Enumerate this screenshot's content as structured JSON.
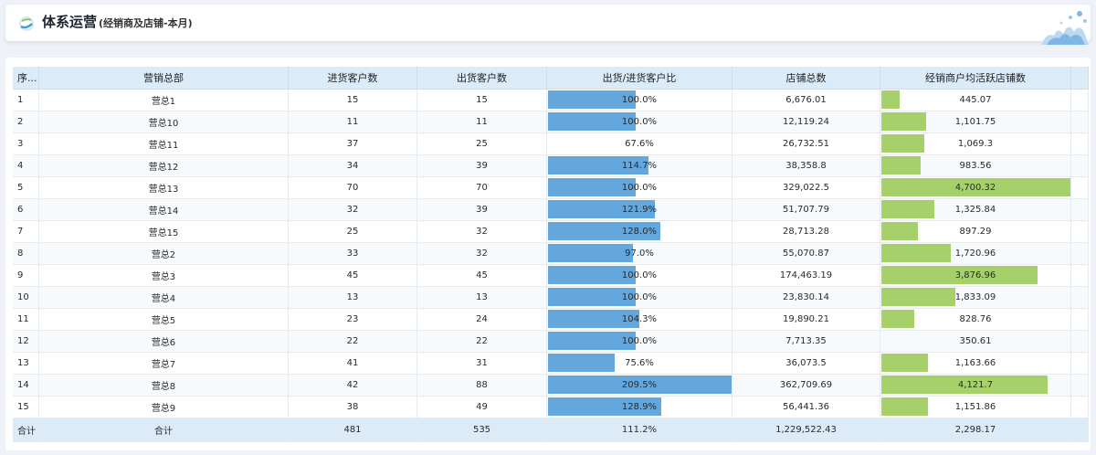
{
  "header": {
    "title": "体系运营",
    "subtitle": "(经销商及店铺-本月)"
  },
  "colors": {
    "ratio_bar": "#63a7dd",
    "avg_bar": "#a6d16a",
    "header_bg": "#dcebf8"
  },
  "table": {
    "columns": [
      "序...",
      "营销总部",
      "进货客户数",
      "出货客户数",
      "出货/进货客户比",
      "店铺总数",
      "经销商户均活跃店铺数"
    ],
    "rows": [
      {
        "idx": "1",
        "dept": "营总1",
        "in": "15",
        "out": "15",
        "ratio": "100.0%",
        "ratio_v": 100.0,
        "stores": "6,676.01",
        "avg": "445.07",
        "avg_v": 445.07
      },
      {
        "idx": "2",
        "dept": "营总10",
        "in": "11",
        "out": "11",
        "ratio": "100.0%",
        "ratio_v": 100.0,
        "stores": "12,119.24",
        "avg": "1,101.75",
        "avg_v": 1101.75
      },
      {
        "idx": "3",
        "dept": "营总11",
        "in": "37",
        "out": "25",
        "ratio": "67.6%",
        "ratio_v": 67.6,
        "stores": "26,732.51",
        "avg": "1,069.3",
        "avg_v": 1069.3
      },
      {
        "idx": "4",
        "dept": "营总12",
        "in": "34",
        "out": "39",
        "ratio": "114.7%",
        "ratio_v": 114.7,
        "stores": "38,358.8",
        "avg": "983.56",
        "avg_v": 983.56
      },
      {
        "idx": "5",
        "dept": "营总13",
        "in": "70",
        "out": "70",
        "ratio": "100.0%",
        "ratio_v": 100.0,
        "stores": "329,022.5",
        "avg": "4,700.32",
        "avg_v": 4700.32
      },
      {
        "idx": "6",
        "dept": "营总14",
        "in": "32",
        "out": "39",
        "ratio": "121.9%",
        "ratio_v": 121.9,
        "stores": "51,707.79",
        "avg": "1,325.84",
        "avg_v": 1325.84
      },
      {
        "idx": "7",
        "dept": "营总15",
        "in": "25",
        "out": "32",
        "ratio": "128.0%",
        "ratio_v": 128.0,
        "stores": "28,713.28",
        "avg": "897.29",
        "avg_v": 897.29
      },
      {
        "idx": "8",
        "dept": "营总2",
        "in": "33",
        "out": "32",
        "ratio": "97.0%",
        "ratio_v": 97.0,
        "stores": "55,070.87",
        "avg": "1,720.96",
        "avg_v": 1720.96
      },
      {
        "idx": "9",
        "dept": "营总3",
        "in": "45",
        "out": "45",
        "ratio": "100.0%",
        "ratio_v": 100.0,
        "stores": "174,463.19",
        "avg": "3,876.96",
        "avg_v": 3876.96
      },
      {
        "idx": "10",
        "dept": "营总4",
        "in": "13",
        "out": "13",
        "ratio": "100.0%",
        "ratio_v": 100.0,
        "stores": "23,830.14",
        "avg": "1,833.09",
        "avg_v": 1833.09
      },
      {
        "idx": "11",
        "dept": "营总5",
        "in": "23",
        "out": "24",
        "ratio": "104.3%",
        "ratio_v": 104.3,
        "stores": "19,890.21",
        "avg": "828.76",
        "avg_v": 828.76
      },
      {
        "idx": "12",
        "dept": "营总6",
        "in": "22",
        "out": "22",
        "ratio": "100.0%",
        "ratio_v": 100.0,
        "stores": "7,713.35",
        "avg": "350.61",
        "avg_v": 350.61
      },
      {
        "idx": "13",
        "dept": "营总7",
        "in": "41",
        "out": "31",
        "ratio": "75.6%",
        "ratio_v": 75.6,
        "stores": "36,073.5",
        "avg": "1,163.66",
        "avg_v": 1163.66
      },
      {
        "idx": "14",
        "dept": "营总8",
        "in": "42",
        "out": "88",
        "ratio": "209.5%",
        "ratio_v": 209.5,
        "stores": "362,709.69",
        "avg": "4,121.7",
        "avg_v": 4121.7
      },
      {
        "idx": "15",
        "dept": "营总9",
        "in": "38",
        "out": "49",
        "ratio": "128.9%",
        "ratio_v": 128.9,
        "stores": "56,441.36",
        "avg": "1,151.86",
        "avg_v": 1151.86
      }
    ],
    "total": {
      "idx": "合计",
      "dept": "合计",
      "in": "481",
      "out": "535",
      "ratio": "111.2%",
      "stores": "1,229,522.43",
      "avg": "2,298.17"
    }
  }
}
